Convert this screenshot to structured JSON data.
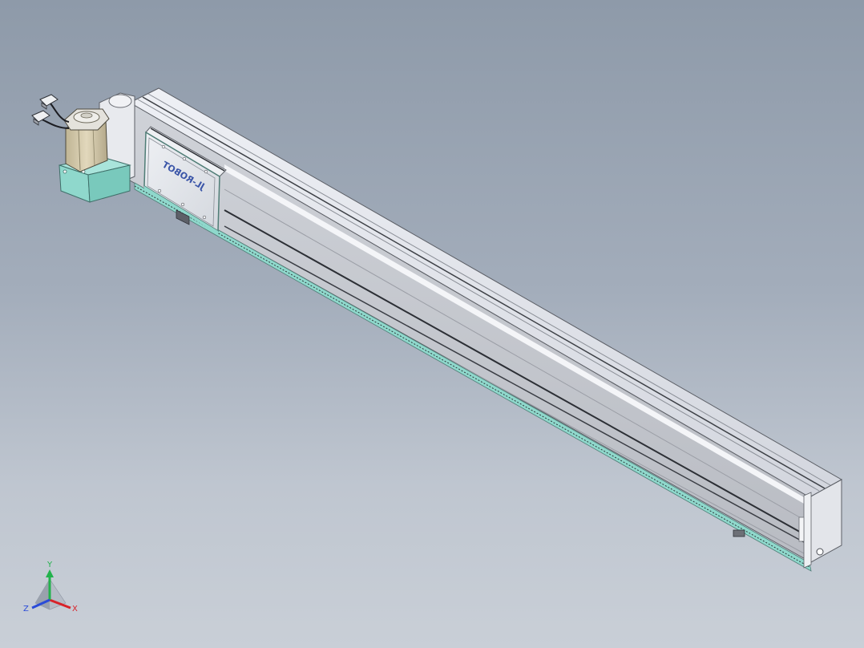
{
  "viewport": {
    "background_top": "#8e9aa9",
    "background_bottom": "#c9cfd7"
  },
  "model": {
    "carriage_logo_text": "JL-ROBOT",
    "colors": {
      "profile_top": "#d9dbe3",
      "profile_side": "#c3c6cc",
      "profile_highlight": "#f2f3f7",
      "accent_teal": "#8fd8cc",
      "motor_body": "#d8cdb0",
      "motor_flange": "#e4e2dc",
      "logo_blue": "#3a55a8"
    },
    "icons": [
      "stepper-motor-icon",
      "cable-connector-icon",
      "carriage-plate-icon",
      "end-cap-icon"
    ]
  },
  "triad": {
    "x_label": "X",
    "y_label": "Y",
    "z_label": "Z",
    "x_color": "#d8232a",
    "y_color": "#22b24c",
    "z_color": "#2a4bd8"
  }
}
